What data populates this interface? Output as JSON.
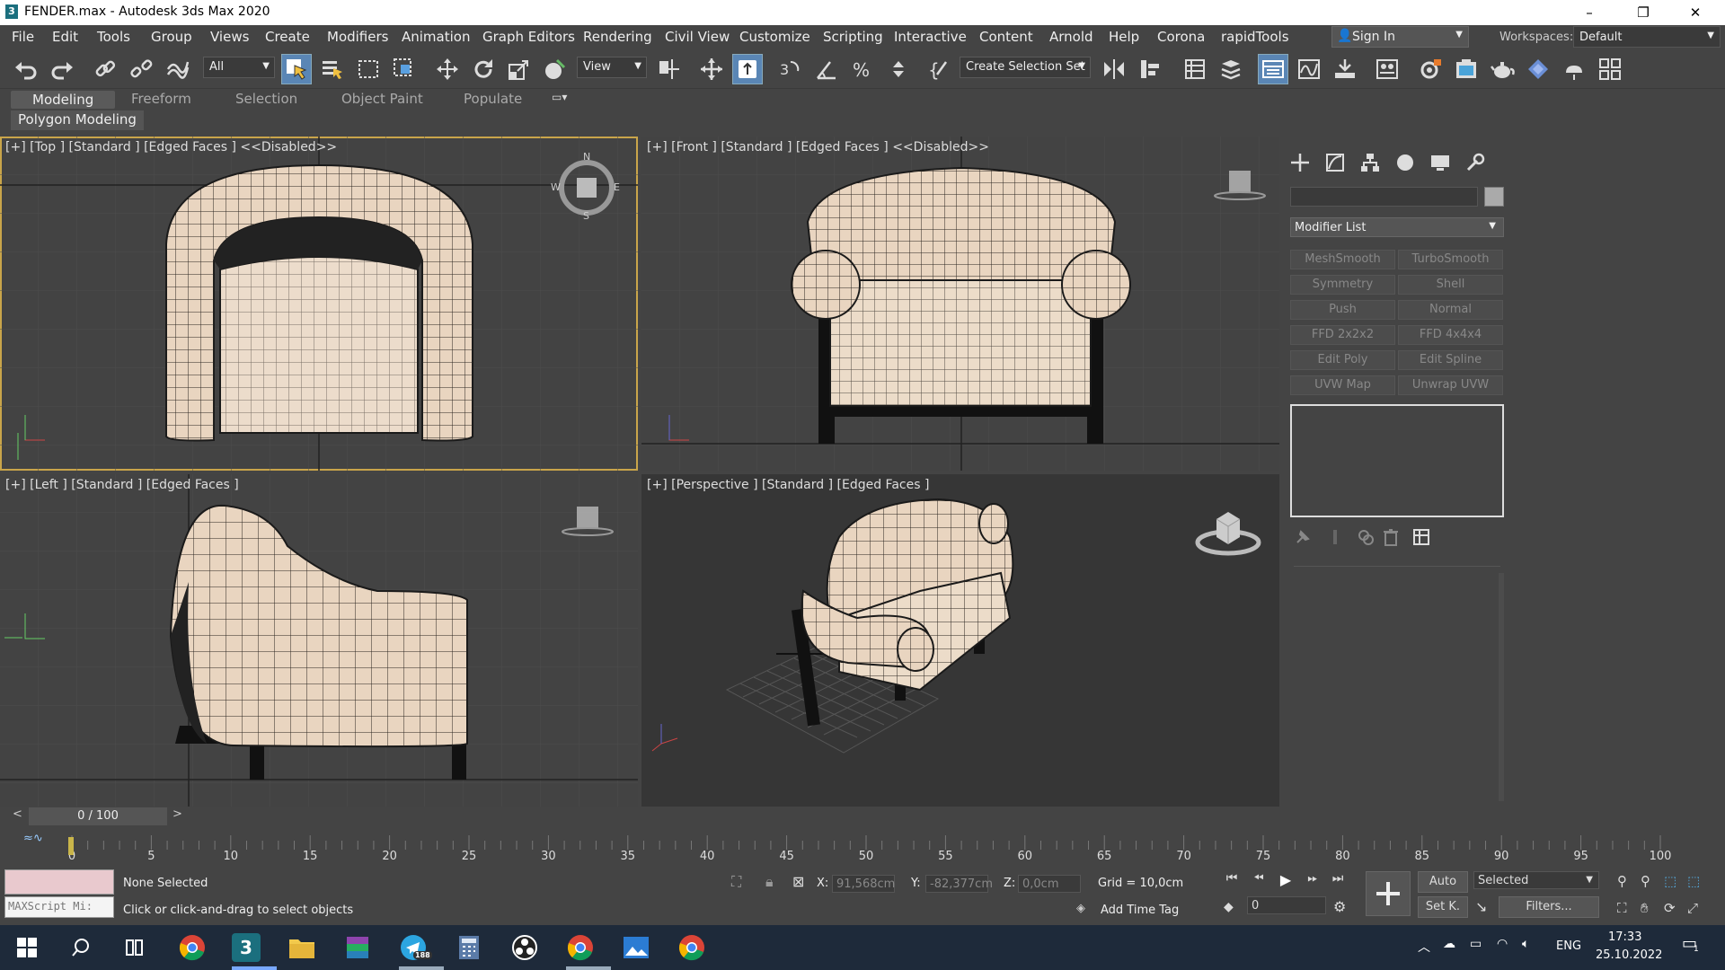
{
  "window": {
    "title": "FENDER.max - Autodesk 3ds Max 2020",
    "app_icon": "3",
    "min": "–",
    "max": "❐",
    "close": "✕"
  },
  "menu": [
    "File",
    "Edit",
    "Tools",
    "Group",
    "Views",
    "Create",
    "Modifiers",
    "Animation",
    "Graph Editors",
    "Rendering",
    "Civil View",
    "Customize",
    "Scripting",
    "Interactive",
    "Content",
    "Arnold",
    "Help",
    "Corona",
    "rapidTools"
  ],
  "signin": "Sign In",
  "workspaces": {
    "label": "Workspaces:",
    "value": "Default"
  },
  "toolbar": {
    "filter": "All",
    "refcoord": "View",
    "selset": "Create Selection Set"
  },
  "ribbon": {
    "tabs": [
      "Modeling",
      "Freeform",
      "Selection",
      "Object Paint",
      "Populate"
    ],
    "sub": "Polygon Modeling"
  },
  "viewports": {
    "top": "[+] [Top ] [Standard ] [Edged Faces ]  <<Disabled>>",
    "front": "[+] [Front ] [Standard ] [Edged Faces ]  <<Disabled>>",
    "left": "[+] [Left ] [Standard ] [Edged Faces ]",
    "persp": "[+] [Perspective ] [Standard ] [Edged Faces ]",
    "compass": {
      "n": "N",
      "s": "S",
      "e": "E",
      "w": "W"
    }
  },
  "command_panel": {
    "modifier_list": "Modifier List",
    "buttons": [
      "MeshSmooth",
      "TurboSmooth",
      "Symmetry",
      "Shell",
      "Push",
      "Normal",
      "FFD 2x2x2",
      "FFD 4x4x4",
      "Edit Poly",
      "Edit Spline",
      "UVW Map",
      "Unwrap UVW"
    ]
  },
  "timeslider": {
    "value": "0 / 100",
    "prev": "<",
    "next": ">"
  },
  "timeline": {
    "ticks": [
      "0",
      "5",
      "10",
      "15",
      "20",
      "25",
      "30",
      "35",
      "40",
      "45",
      "50",
      "55",
      "60",
      "65",
      "70",
      "75",
      "80",
      "85",
      "90",
      "95",
      "100"
    ]
  },
  "status": {
    "maxscript": "MAXScript Mi:",
    "selection": "None Selected",
    "prompt": "Click or click-and-drag to select objects",
    "x_label": "X:",
    "x": "91,568cm",
    "y_label": "Y:",
    "y": "-82,377cm",
    "z_label": "Z:",
    "z": "0,0cm",
    "grid": "Grid = 10,0cm",
    "add_time_tag": "Add Time Tag",
    "auto": "Auto",
    "setk": "Set K.",
    "selected": "Selected",
    "filters": "Filters...",
    "frame": "0"
  },
  "taskbar": {
    "lang": "ENG",
    "time": "17:33",
    "date": "25.10.2022",
    "notif": "1",
    "telegram_badge": "188"
  },
  "colors": {
    "sofa": "#e9d5c0",
    "accent": "#5a86b5",
    "active_border": "#c9a54a"
  }
}
